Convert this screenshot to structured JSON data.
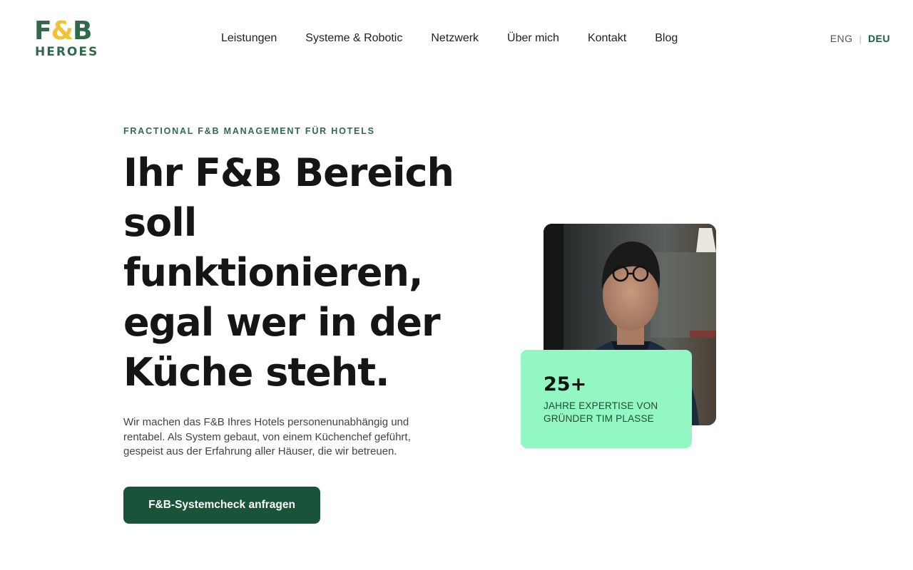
{
  "brand": {
    "logo_top_left": "F",
    "logo_ampersand": "&",
    "logo_top_right": "B",
    "logo_bottom": "HEROES",
    "colors": {
      "green": "#2f6b4a",
      "yellow": "#f2c230"
    }
  },
  "nav": {
    "items": [
      {
        "label": "Leistungen"
      },
      {
        "label": "Systeme & Robotic"
      },
      {
        "label": "Netzwerk"
      },
      {
        "label": "Über mich"
      },
      {
        "label": "Kontakt"
      },
      {
        "label": "Blog"
      }
    ]
  },
  "language": {
    "options": [
      "ENG",
      "DEU"
    ],
    "active": "DEU"
  },
  "hero": {
    "eyebrow": "FRACTIONAL F&B MANAGEMENT FÜR HOTELS",
    "headline": "Ihr F&B Bereich soll funktionieren, egal wer in der Küche steht.",
    "lead": "Wir machen das F&B Ihres Hotels personenunabhängig und rentabel. Als System gebaut, von einem Küchenchef geführt, gespeist aus der Erfahrung aller Häuser, die wir betreuen.",
    "cta_label": "F&B-Systemcheck anfragen",
    "cta_color": "#18533a"
  },
  "stat_card": {
    "value": "25+",
    "label": "Jahre Expertise von Gründer Tim Plasse",
    "color": "#92f7c3"
  }
}
